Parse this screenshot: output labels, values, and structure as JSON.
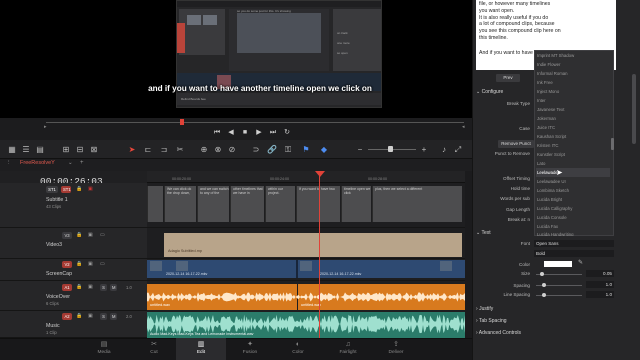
{
  "viewer": {
    "subtitle_text": "and if you want to have another timeline open we click on",
    "inner_caption": "so you do some just for this. It's showing",
    "inner_label": "Refind Boards bee",
    "inner_notes": [
      "on track",
      "one more",
      "so open"
    ]
  },
  "transport": {
    "buttons": [
      "skip-start",
      "prev-frame",
      "stop",
      "play",
      "next-frame",
      "loop"
    ]
  },
  "timeline": {
    "tab_name": "FreeResolveY",
    "timecode": "00:00:26:03",
    "ruler_ticks": [
      "00:00:20:00",
      "00:00:24:00",
      "00:00:28:00"
    ],
    "tracks": [
      {
        "id": "ST1",
        "badge": "ST1",
        "name": "Subtitle 1",
        "sub": "43 Clips"
      },
      {
        "id": "V3",
        "badge": "V3",
        "name": "Video3",
        "sub": ""
      },
      {
        "id": "V2",
        "badge": "V2",
        "name": "ScreenCap",
        "sub": ""
      },
      {
        "id": "A1",
        "badge": "A1",
        "name": "VoiceOver",
        "sub": "6 Clips"
      },
      {
        "id": "A2",
        "badge": "A2",
        "name": "Music",
        "sub": "1 Clip"
      }
    ],
    "subtitle_clips": [
      "We can click ok the drop down,",
      "and we can switch to any of the",
      "other timelines that we have in",
      "within our project.",
      "If you want to have two",
      "timeline open we click",
      "plus, then we select a different"
    ],
    "v3_clip_label": "Adagio Subtitled.mp",
    "v2_clip_labels": [
      "2020-12-14 16-17-22.mkv",
      "2020-12-14 16-17-22.mkv"
    ],
    "a1_clip_labels": [
      "untitled.wav",
      "untitled.wav"
    ],
    "a2_clip_label": "Audio Mad-Keys Mad-Keys Tea and Lemonade Instrumental.wav",
    "pages": [
      "Media",
      "Cut",
      "Edit",
      "Fusion",
      "Color",
      "Fairlight",
      "Deliver"
    ],
    "active_page": "Edit"
  },
  "inspector": {
    "text_lines": [
      "file, or however many timelines",
      "you want open.",
      "It is also really useful if you do",
      "a lot of compound clips, because",
      "you see this compound clip here on",
      "this timeline."
    ],
    "text2": "And if you want to have",
    "prev_label": "Prev",
    "configure_label": "Configure",
    "break_type_label": "Break Type",
    "case_label": "Case",
    "remove_punct_label": "Remove Punct",
    "punct_to_remove_label": "Punct to Remove",
    "offset_timing_label": "Offset Timing",
    "hold_time_label": "Hold time",
    "words_per_sub_label": "Words per sub",
    "gap_length_label": "Gap Length",
    "break_at_label": "Break at: n",
    "text_section": "Text",
    "font_label": "Font",
    "font_value": "Open Sans",
    "style_value": "Bold",
    "color_label": "Color",
    "size_label": "Size",
    "size_value": "0.05",
    "spacing_label": "Spacing",
    "spacing_value": "1.0",
    "line_spacing_label": "Line Spacing",
    "line_spacing_value": "1.0",
    "justify_label": "Justify",
    "tab_spacing_label": "Tab Spacing",
    "advanced_label": "Advanced Controls",
    "font_list": [
      "Imprint MT Shadow",
      "Indie Flower",
      "Informal Roman",
      "Ink Free",
      "Inject Mono",
      "Inter",
      "Javanese Text",
      "Jokerman",
      "Juice ITC",
      "Kaushan Script",
      "Kristen ITC",
      "Kunstler Script",
      "Lato",
      "Leelawadee",
      "Leelawadee UI",
      "Lombima Sketch",
      "Lucida Bright",
      "Lucida Calligraphy",
      "Lucida Console",
      "Lucida Fax",
      "Lucida Handwriting"
    ],
    "selected_font": "Leelawadee"
  },
  "colors": {
    "playhead": "#e04238",
    "voiceover": "#d87a1e",
    "music": "#2b7c6a",
    "screencap": "#2e4a72",
    "video3": "#b8a48a",
    "accent_blue": "#4d8cf0"
  }
}
